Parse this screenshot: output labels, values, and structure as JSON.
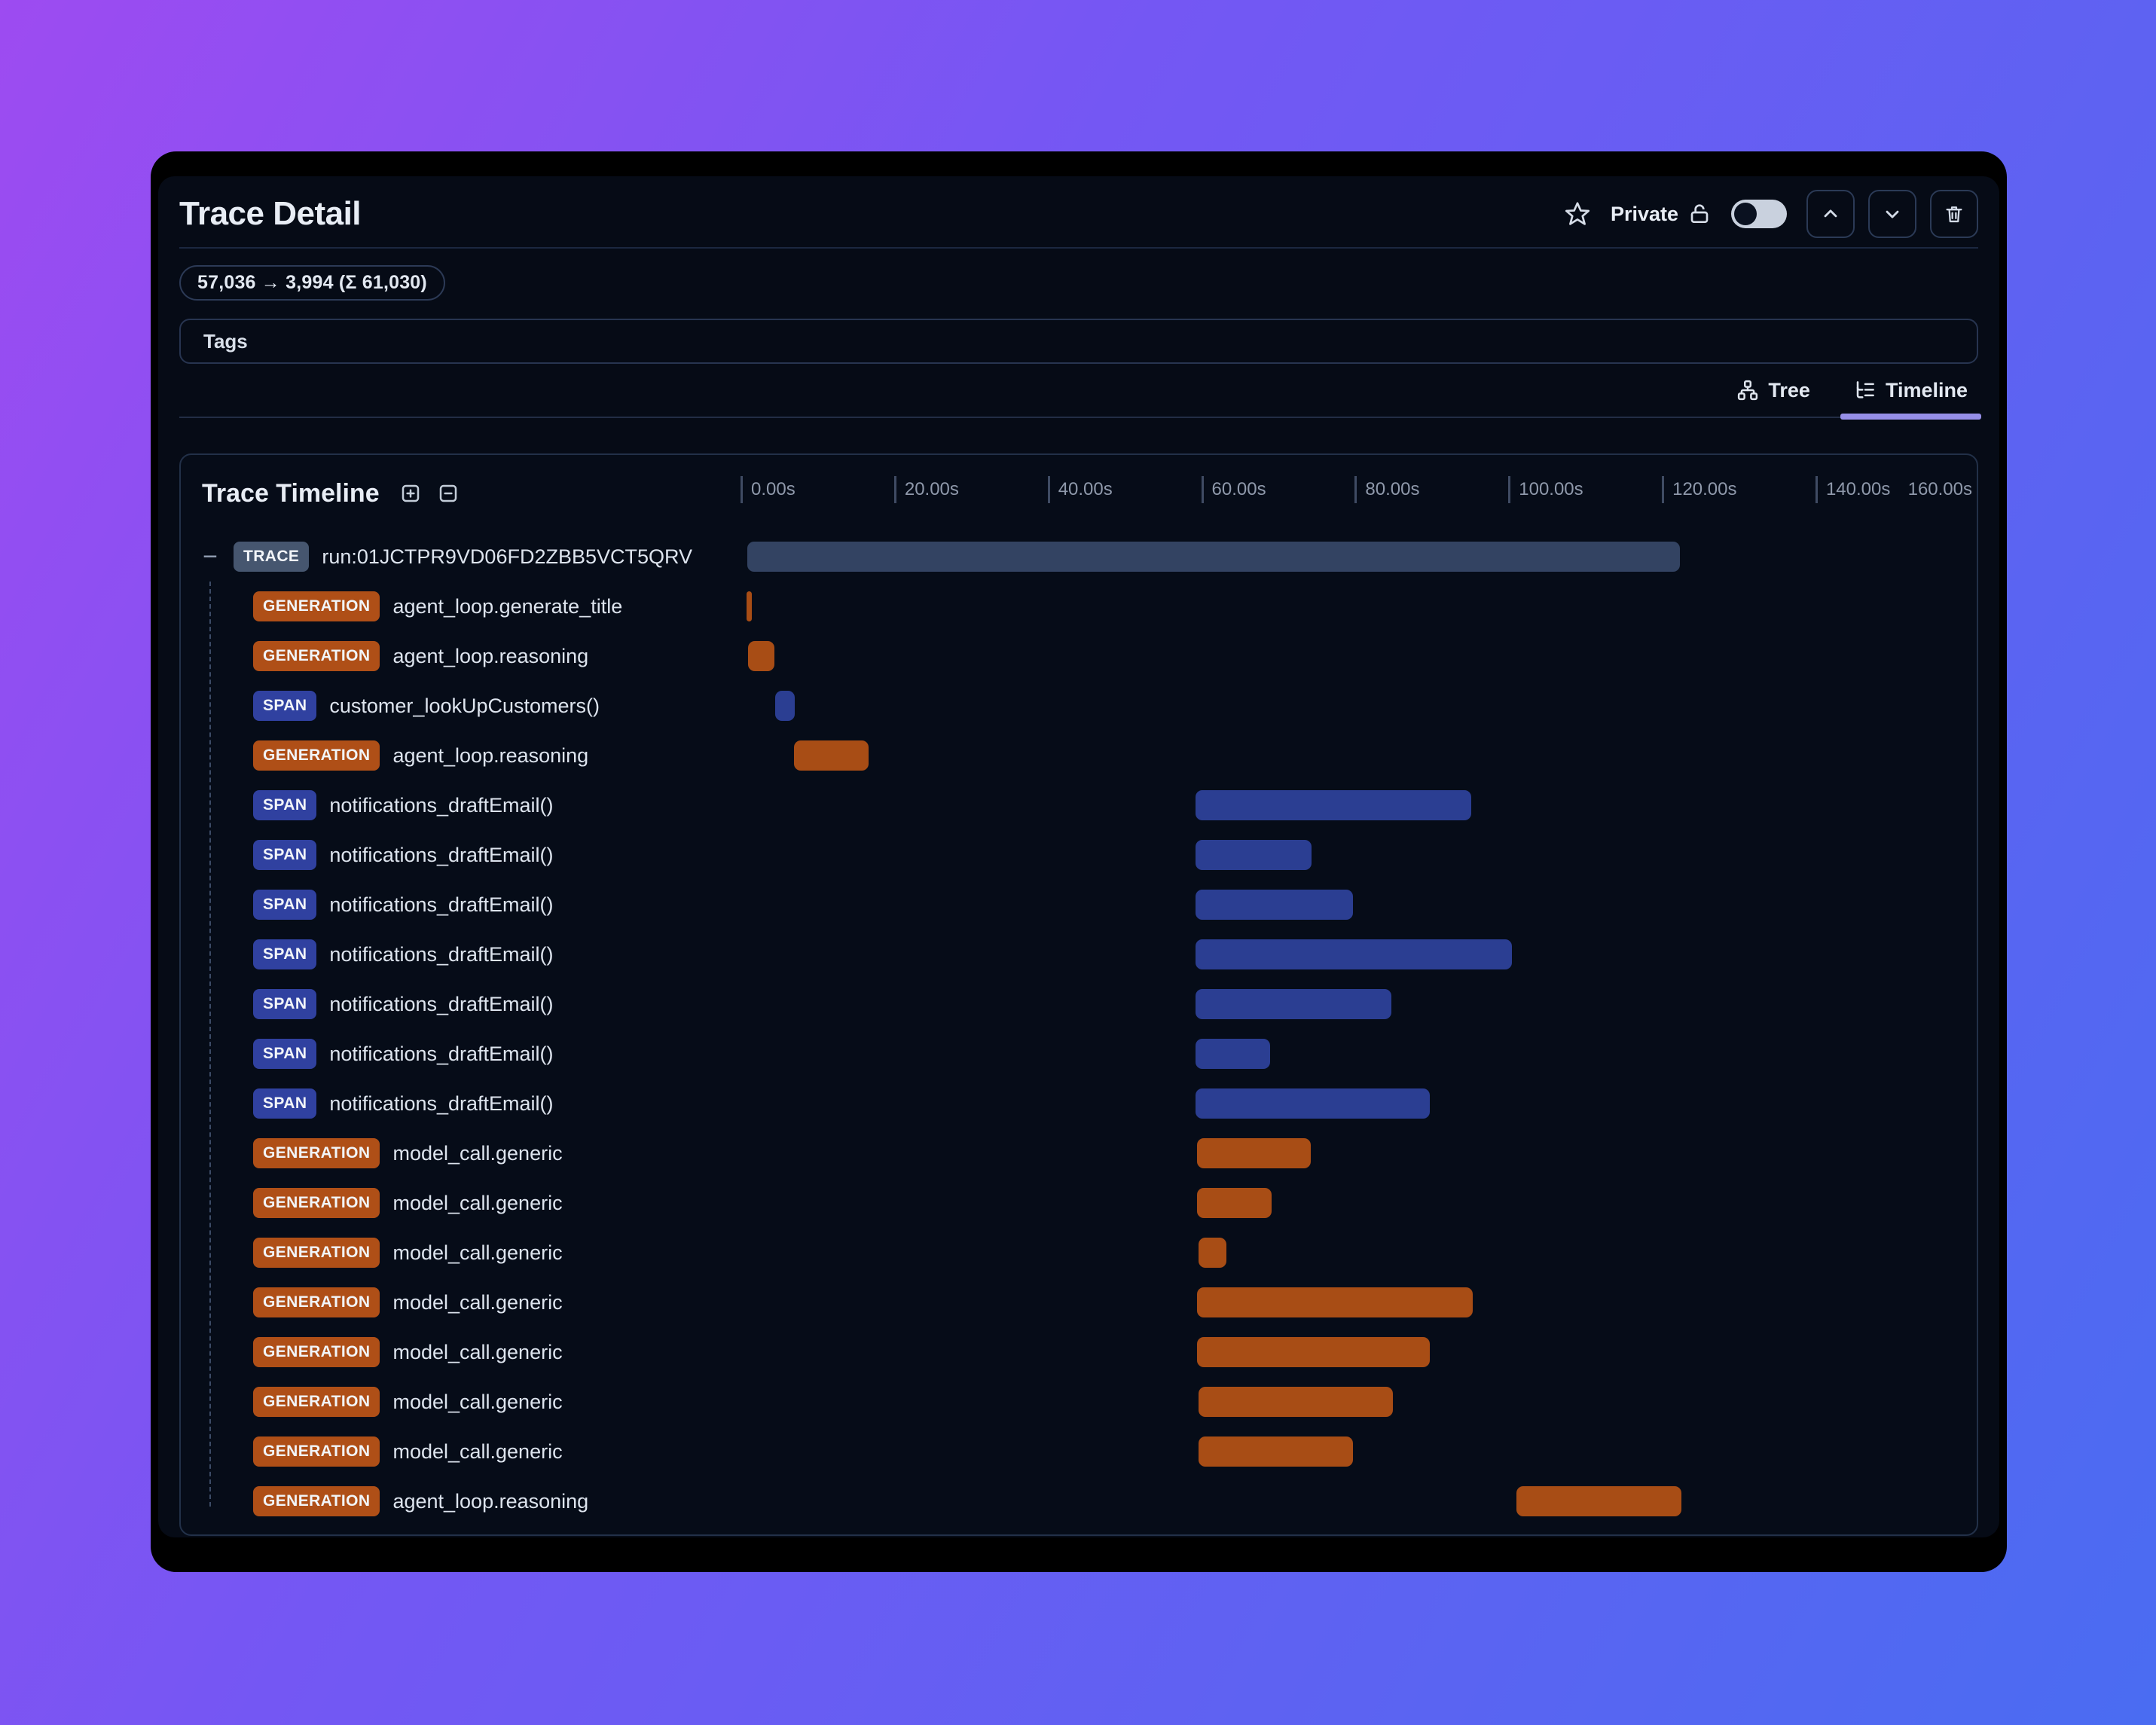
{
  "header": {
    "title": "Trace Detail",
    "privacy_label": "Private",
    "toggle_state": "off"
  },
  "token_badge": "57,036 → 3,994 (Σ 61,030)",
  "tags": {
    "label": "Tags"
  },
  "view_tabs": [
    {
      "label": "Tree",
      "icon": "tree-icon",
      "active": false
    },
    {
      "label": "Timeline",
      "icon": "timeline-icon",
      "active": true
    }
  ],
  "timeline": {
    "title": "Trace Timeline",
    "axis": {
      "ticks": [
        {
          "label": "0.00s",
          "seconds": 0
        },
        {
          "label": "20.00s",
          "seconds": 20
        },
        {
          "label": "40.00s",
          "seconds": 40
        },
        {
          "label": "60.00s",
          "seconds": 60
        },
        {
          "label": "80.00s",
          "seconds": 80
        },
        {
          "label": "100.00s",
          "seconds": 100
        },
        {
          "label": "120.00s",
          "seconds": 120
        },
        {
          "label": "140.00s",
          "seconds": 140
        }
      ],
      "end_label": "160.00s",
      "max_seconds": 161
    },
    "rows": [
      {
        "type": "TRACE",
        "name": "run:01JCTPR9VD06FD2ZBB5VCT5QRV",
        "start": 0.9,
        "end": 122.3
      },
      {
        "type": "GENERATION",
        "name": "agent_loop.generate_title",
        "start": 0.8,
        "end": 1.5
      },
      {
        "type": "GENERATION",
        "name": "agent_loop.reasoning",
        "start": 1.0,
        "end": 4.4
      },
      {
        "type": "SPAN",
        "name": "customer_lookUpCustomers()",
        "start": 4.5,
        "end": 7.1
      },
      {
        "type": "GENERATION",
        "name": "agent_loop.reasoning",
        "start": 7.0,
        "end": 16.7
      },
      {
        "type": "SPAN",
        "name": "notifications_draftEmail()",
        "start": 59.3,
        "end": 95.2
      },
      {
        "type": "SPAN",
        "name": "notifications_draftEmail()",
        "start": 59.3,
        "end": 74.4
      },
      {
        "type": "SPAN",
        "name": "notifications_draftEmail()",
        "start": 59.3,
        "end": 79.8
      },
      {
        "type": "SPAN",
        "name": "notifications_draftEmail()",
        "start": 59.3,
        "end": 100.5
      },
      {
        "type": "SPAN",
        "name": "notifications_draftEmail()",
        "start": 59.3,
        "end": 84.8
      },
      {
        "type": "SPAN",
        "name": "notifications_draftEmail()",
        "start": 59.3,
        "end": 69.0
      },
      {
        "type": "SPAN",
        "name": "notifications_draftEmail()",
        "start": 59.3,
        "end": 89.8
      },
      {
        "type": "GENERATION",
        "name": "model_call.generic",
        "start": 59.5,
        "end": 74.3
      },
      {
        "type": "GENERATION",
        "name": "model_call.generic",
        "start": 59.5,
        "end": 69.2
      },
      {
        "type": "GENERATION",
        "name": "model_call.generic",
        "start": 59.7,
        "end": 63.3
      },
      {
        "type": "GENERATION",
        "name": "model_call.generic",
        "start": 59.5,
        "end": 95.4
      },
      {
        "type": "GENERATION",
        "name": "model_call.generic",
        "start": 59.5,
        "end": 89.8
      },
      {
        "type": "GENERATION",
        "name": "model_call.generic",
        "start": 59.7,
        "end": 85.0
      },
      {
        "type": "GENERATION",
        "name": "model_call.generic",
        "start": 59.7,
        "end": 79.8
      },
      {
        "type": "GENERATION",
        "name": "agent_loop.reasoning",
        "start": 101.1,
        "end": 122.5
      }
    ]
  },
  "colors": {
    "accent_purple": "#968fe8",
    "trace_bar": "#334362",
    "generation_bar": "#a84d15",
    "span_bar": "#2b3e92",
    "trace_badge": "#46566f",
    "generation_badge": "#af4f17",
    "span_badge": "#3041a0"
  }
}
